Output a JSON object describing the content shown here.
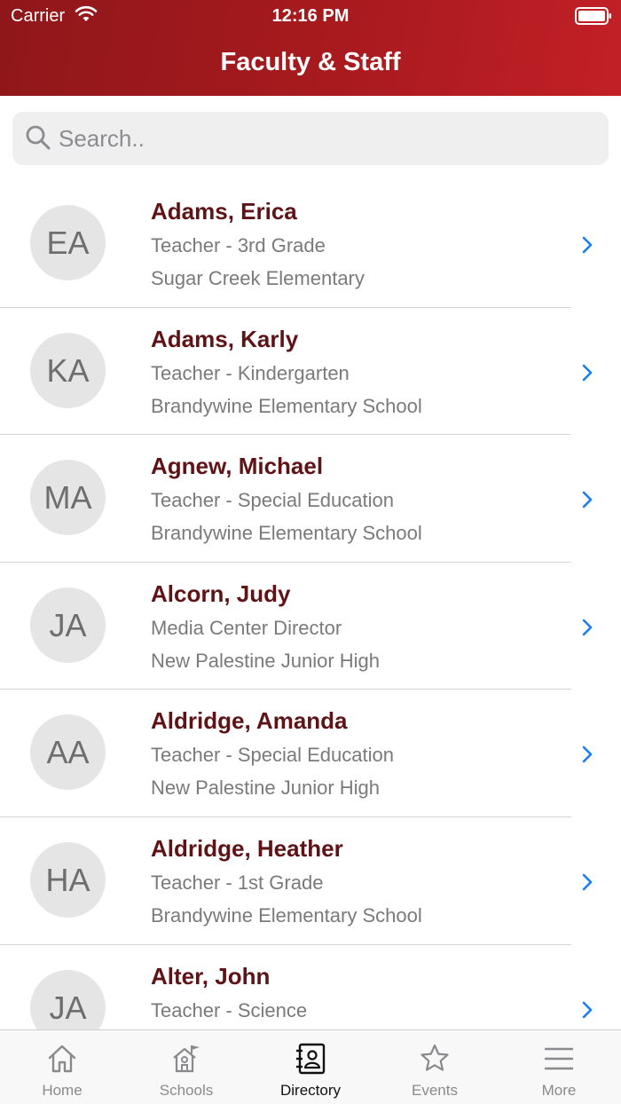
{
  "status_bar": {
    "carrier": "Carrier",
    "time": "12:16 PM"
  },
  "header": {
    "title": "Faculty & Staff"
  },
  "search": {
    "placeholder": "Search.."
  },
  "staff": [
    {
      "initials": "EA",
      "name": "Adams, Erica",
      "role": "Teacher - 3rd Grade",
      "school": "Sugar Creek Elementary"
    },
    {
      "initials": "KA",
      "name": "Adams, Karly",
      "role": "Teacher - Kindergarten",
      "school": "Brandywine Elementary School"
    },
    {
      "initials": "MA",
      "name": "Agnew, Michael",
      "role": "Teacher - Special Education",
      "school": "Brandywine Elementary School"
    },
    {
      "initials": "JA",
      "name": "Alcorn, Judy",
      "role": "Media Center Director",
      "school": "New Palestine Junior High"
    },
    {
      "initials": "AA",
      "name": "Aldridge, Amanda",
      "role": "Teacher - Special Education",
      "school": "New Palestine Junior High"
    },
    {
      "initials": "HA",
      "name": "Aldridge, Heather",
      "role": "Teacher - 1st Grade",
      "school": "Brandywine Elementary School"
    },
    {
      "initials": "JA",
      "name": "Alter, John",
      "role": "Teacher - Science",
      "school": ""
    }
  ],
  "tabs": [
    {
      "label": "Home",
      "icon": "home-icon"
    },
    {
      "label": "Schools",
      "icon": "school-icon"
    },
    {
      "label": "Directory",
      "icon": "directory-icon",
      "active": true
    },
    {
      "label": "Events",
      "icon": "star-icon"
    },
    {
      "label": "More",
      "icon": "menu-icon"
    }
  ],
  "colors": {
    "header": "#a81a1e",
    "name_text": "#5e1417",
    "chevron": "#1a7cf5"
  }
}
